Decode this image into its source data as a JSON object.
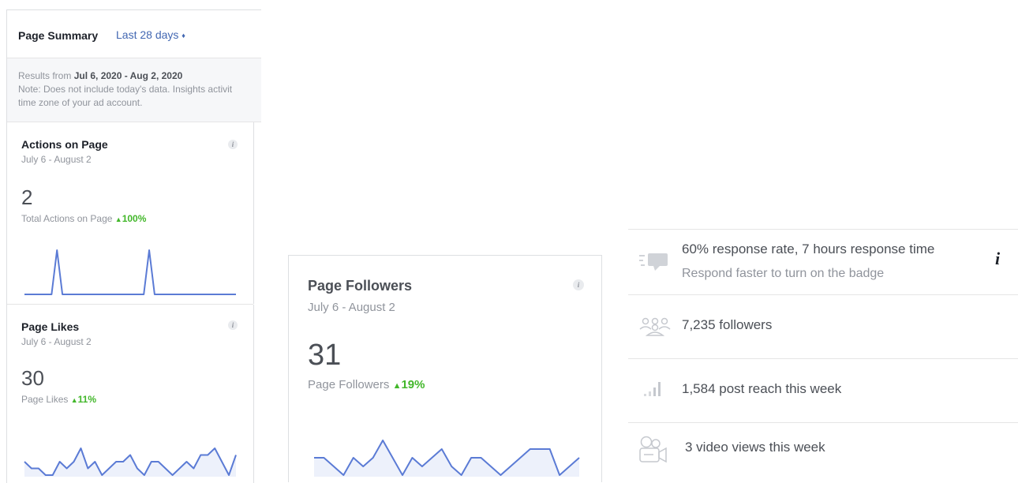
{
  "summary": {
    "title": "Page Summary",
    "range_label": "Last 28 days",
    "results_prefix": "Results from ",
    "results_dates": "Jul 6, 2020 - Aug 2, 2020",
    "note_line1": "Note: Does not include today's data. Insights activit",
    "note_line2": "time zone of your ad account."
  },
  "actions_card": {
    "title": "Actions on Page",
    "date_range": "July 6 - August 2",
    "value": "2",
    "metric_label": "Total Actions on Page",
    "change": "100%",
    "trend": [
      0,
      0,
      0,
      0,
      0,
      0,
      1,
      0,
      0,
      0,
      0,
      0,
      0,
      0,
      0,
      0,
      0,
      0,
      0,
      0,
      0,
      0,
      0,
      1,
      0,
      0,
      0,
      0,
      0,
      0,
      0,
      0,
      0,
      0,
      0,
      0,
      0,
      0,
      0,
      0
    ]
  },
  "likes_card": {
    "title": "Page Likes",
    "date_range": "July 6 - August 2",
    "value": "30",
    "metric_label": "Page Likes",
    "change": "11%",
    "trend": [
      2,
      1,
      1,
      0,
      0,
      2,
      1,
      2,
      4,
      1,
      2,
      0,
      1,
      2,
      2,
      3,
      1,
      0,
      2,
      2,
      1,
      0,
      1,
      2,
      1,
      3,
      3,
      4,
      2,
      0,
      3
    ]
  },
  "followers_card": {
    "title": "Page Followers",
    "date_range": "July 6 - August 2",
    "value": "31",
    "metric_label": "Page Followers",
    "change": "19%",
    "trend": [
      2,
      2,
      1,
      0,
      2,
      1,
      2,
      4,
      2,
      0,
      2,
      1,
      2,
      3,
      1,
      0,
      2,
      2,
      1,
      0,
      1,
      2,
      3,
      3,
      3,
      0,
      1,
      2
    ]
  },
  "stats": {
    "response_text": "60% response rate, 7 hours response time",
    "response_sub": "Respond faster to turn on the badge",
    "followers_text": "7,235 followers",
    "reach_text": "1,584 post reach this week",
    "video_text": "3 video views this week",
    "icons": [
      "message-icon",
      "people-icon",
      "bar-chart-icon",
      "video-camera-icon",
      "info-icon"
    ]
  },
  "colors": {
    "link": "#4267b2",
    "line": "#5b7bd5",
    "fill": "#edf1fb",
    "positive": "#42b72a"
  }
}
